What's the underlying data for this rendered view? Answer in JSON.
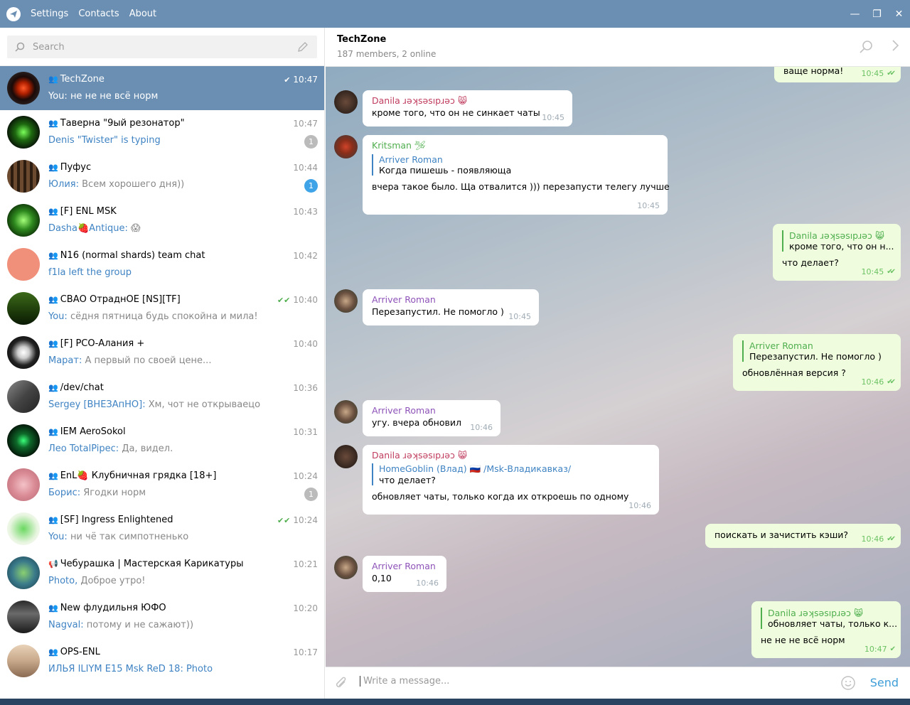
{
  "menu": {
    "settings": "Settings",
    "contacts": "Contacts",
    "about": "About"
  },
  "window_controls": {
    "minimize": "—",
    "maximize": "❐",
    "close": "✕"
  },
  "search": {
    "placeholder": "Search"
  },
  "chats": [
    {
      "title": "TechZone",
      "time": "10:47",
      "check": "✔",
      "sender": "You:",
      "preview": "не не не всё норм",
      "badge": "",
      "active": true
    },
    {
      "title": "Таверна \"9ый резонатор\"",
      "time": "10:47",
      "check": "",
      "sender": "",
      "preview": "Denis \"Twister\" is typing",
      "preview_colored": true,
      "badge": "1"
    },
    {
      "title": "Пуфус",
      "time": "10:44",
      "check": "",
      "sender": "Юлия:",
      "preview": "Всем хорошего дня))",
      "badge": "1",
      "badge_blue": true
    },
    {
      "title": "[F] ENL MSK",
      "time": "10:43",
      "check": "",
      "sender": "Dasha🍓Antique:",
      "preview": "😱",
      "badge": ""
    },
    {
      "title": "N16 (normal shards) team chat",
      "time": "10:42",
      "check": "",
      "sender": "",
      "preview": "f1la left the group",
      "preview_colored": true,
      "badge": ""
    },
    {
      "title": "СВАО ОтраднОЕ [NS][TF]",
      "time": "10:40",
      "check": "✔✔",
      "sender": "You:",
      "preview": "сёдня пятница будь спокойна и мила!",
      "badge": ""
    },
    {
      "title": "[F] РСО-Алания +",
      "time": "10:40",
      "check": "",
      "sender": "Марат:",
      "preview": "А первый по своей цене...",
      "badge": ""
    },
    {
      "title": "/dev/chat",
      "time": "10:36",
      "check": "",
      "sender": "Sergey [ВНЕЗАпНО]:",
      "preview": "Хм, чот не открываецо",
      "badge": ""
    },
    {
      "title": "IEM AeroSokol",
      "time": "10:31",
      "check": "",
      "sender": "Лео TotalPipec:",
      "preview": "Да, видел.",
      "badge": ""
    },
    {
      "title": "EnL🍓 Клубничная грядка [18+]",
      "time": "10:24",
      "check": "",
      "sender": "Борис:",
      "preview": "Ягодки норм",
      "badge": "1"
    },
    {
      "title": "[SF] Ingress Enlightened",
      "time": "10:24",
      "check": "✔✔",
      "sender": "You:",
      "preview": "ни чё так симпотненько",
      "badge": ""
    },
    {
      "title": "Чебурашка | Мастерская Карикатуры",
      "time": "10:21",
      "check": "",
      "sender": "Photo,",
      "preview": "Доброе утро!",
      "badge": "",
      "channel": true
    },
    {
      "title": "New флудильня ЮФО",
      "time": "10:20",
      "check": "",
      "sender": "Nagval:",
      "preview": "потому и не сажают))",
      "badge": ""
    },
    {
      "title": "OPS-ENL",
      "time": "10:17",
      "check": "",
      "sender": "",
      "preview": "ИЛЬЯ ILIYM E15 Msk ReD 18: Photo",
      "preview_colored": true,
      "badge": ""
    }
  ],
  "header": {
    "title": "TechZone",
    "subtitle": "187 members, 2 online"
  },
  "messages": {
    "m0": {
      "text": "ваще норма!",
      "time": "10:45"
    },
    "m1": {
      "sender": "Danila ɹǝʞsǝsıpɹǝɔ 😸",
      "text": "кроме того, что он не синкает чаты",
      "time": "10:45"
    },
    "m2": {
      "sender": "Kritsman 🛩",
      "reply_name": "Arriver Roman",
      "reply_text": "Когда пишешь - появляюща",
      "text": "вчера такое было. Ща отвалится ))) перезапусти телегу лучше",
      "time": "10:45"
    },
    "m3": {
      "reply_name": "Danila ɹǝʞsǝsıpɹǝɔ 😸",
      "reply_text": "кроме того, что он н...",
      "text": "что делает?",
      "time": "10:45"
    },
    "m4": {
      "sender": "Arriver Roman",
      "text": "Перезапустил. Не помогло )",
      "time": "10:45"
    },
    "m5": {
      "reply_name": "Arriver Roman",
      "reply_text": "Перезапустил. Не помогло )",
      "text": "обновлённая версия ?",
      "time": "10:46"
    },
    "m6": {
      "sender": "Arriver Roman",
      "text": "угу. вчера обновил",
      "time": "10:46"
    },
    "m7": {
      "sender": "Danila ɹǝʞsǝsıpɹǝɔ 😸",
      "reply_name": "HomeGoblin (Влад) 🇷🇺 /Msk-Владикавказ/",
      "reply_text": "что делает?",
      "text": "обновляет чаты, только когда их откроешь по одному",
      "time": "10:46"
    },
    "m8": {
      "text": "поискать и зачистить кэши?",
      "time": "10:46"
    },
    "m9": {
      "sender": "Arriver Roman",
      "text": "0,10",
      "time": "10:46"
    },
    "m10": {
      "reply_name": "Danila ɹǝʞsǝsıpɹǝɔ 😸",
      "reply_text": "обновляет чаты, только к...",
      "text": "не не не всё норм",
      "time": "10:47"
    }
  },
  "composer": {
    "placeholder": "Write a message...",
    "send": "Send"
  },
  "colors": {
    "accent": "#6b8fb3",
    "link": "#3f83c3",
    "out_bubble": "#effdde",
    "read_check": "#4fae4e"
  }
}
